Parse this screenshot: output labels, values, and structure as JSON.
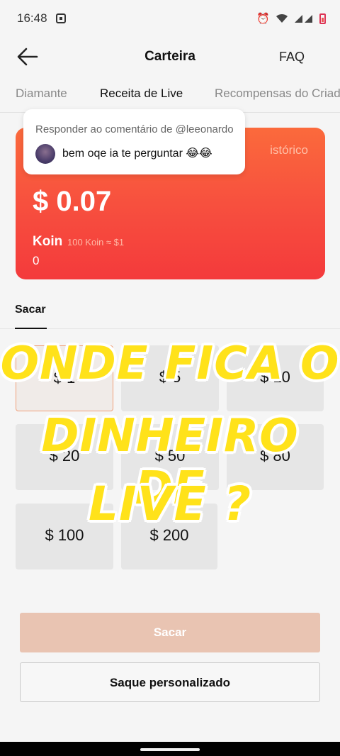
{
  "status_bar": {
    "time": "16:48",
    "icons": [
      "app-notification-icon",
      "alarm-icon",
      "wifi-icon",
      "signal-icon",
      "battery-icon"
    ]
  },
  "header": {
    "title": "Carteira",
    "faq": "FAQ",
    "back_icon": "back-arrow-icon"
  },
  "tabs": [
    {
      "label": "Diamante"
    },
    {
      "label": "Receita de Live"
    },
    {
      "label": "Recompensas do Criad"
    }
  ],
  "card": {
    "history": "istórico",
    "balance": "$ 0.07",
    "koin_label": "Koin",
    "koin_rate": "100 Koin ≈ $1",
    "koin_value": "0",
    "gradient_top": "#fb6a3c",
    "gradient_bottom": "#f43a3c"
  },
  "comment_popup": {
    "reply_to": "Responder ao comentário de @leeonardo",
    "comment": "bem oqe ia te perguntar 😂😂"
  },
  "withdraw": {
    "section_title": "Sacar",
    "options": [
      {
        "label": "$ 1"
      },
      {
        "label": "$ 5"
      },
      {
        "label": "$ 10"
      },
      {
        "label": "$ 20"
      },
      {
        "label": "$ 50"
      },
      {
        "label": "$ 80"
      },
      {
        "label": "$ 100"
      },
      {
        "label": "$ 200"
      }
    ],
    "primary_button": "Sacar",
    "secondary_button": "Saque personalizado"
  },
  "overlay_text": {
    "line1": "ONDE FICA O",
    "line2": "DINHEIRO DE",
    "line3": "LIVE ?"
  },
  "colors": {
    "accent": "#f7503e",
    "overlay_fill": "#ffe21a"
  }
}
